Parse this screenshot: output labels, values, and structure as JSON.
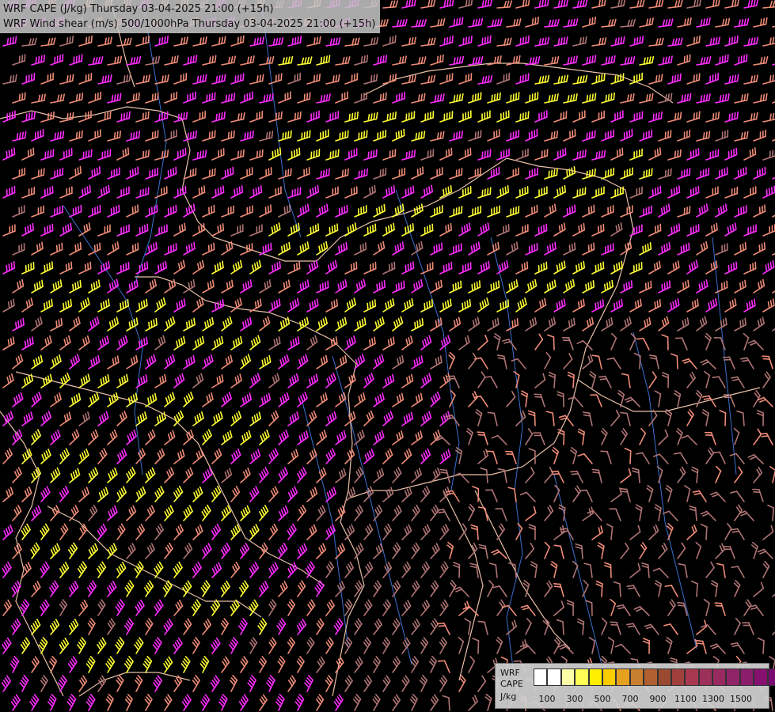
{
  "title_lines": [
    "WRF CAPE (J/kg) Thursday 03-04-2025 21:00 (+15h)",
    "WRF Wind shear (m/s) 500/1000hPa Thursday 03-04-2025 21:00 (+15h)"
  ],
  "legend": {
    "label_lines": [
      "WRF",
      "CAPE",
      "J/kg"
    ],
    "swatch_colors": [
      "#ffffff",
      "#ffffff",
      "#ffffaa",
      "#ffff55",
      "#ffee00",
      "#ffcc00",
      "#e6a020",
      "#c87f30",
      "#b06030",
      "#9a4a30",
      "#a0403c",
      "#a83850",
      "#9c3058",
      "#982a60",
      "#902468",
      "#8a1e6c",
      "#851070",
      "#7a0a72"
    ],
    "tick_labels": [
      "100",
      "300",
      "500",
      "700",
      "900",
      "1100",
      "1300",
      "1500"
    ]
  },
  "barb_colors": {
    "strong": "#ff2dff",
    "moderate": "#f08c78",
    "weak": "#b07474",
    "yellow": "#ffff33"
  },
  "line_colors": {
    "border": "#e8c0a8",
    "river": "#3a70d0"
  }
}
